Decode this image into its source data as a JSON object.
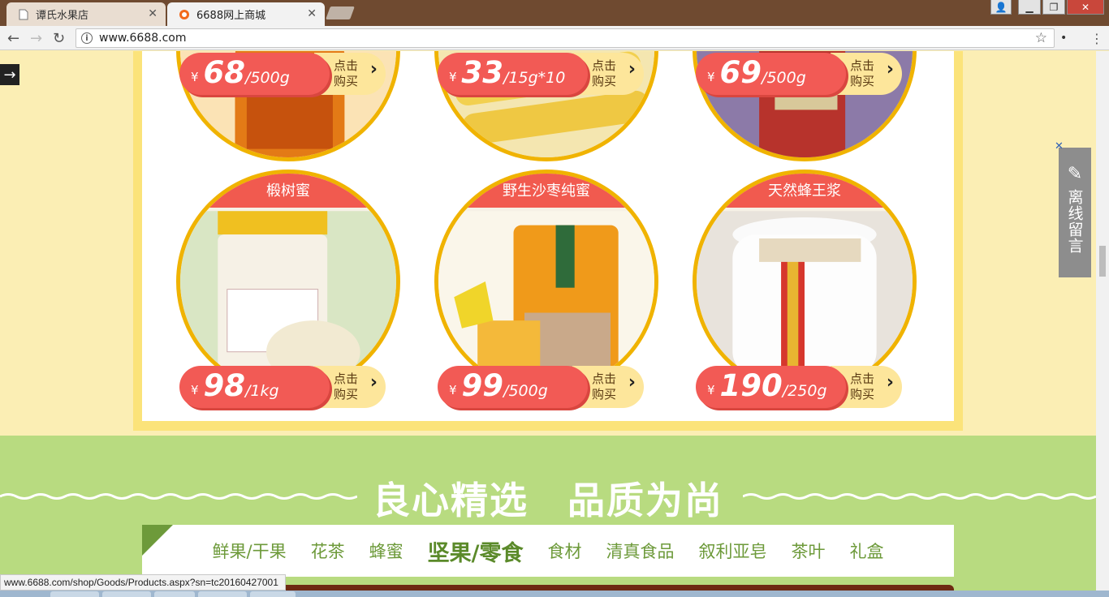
{
  "browser": {
    "tabs": [
      {
        "title": "谭氏水果店",
        "active": false,
        "icon": "page-icon"
      },
      {
        "title": "6688网上商城",
        "active": true,
        "icon": "site-logo-icon"
      }
    ],
    "url": "www.6688.com",
    "status_url": "www.6688.com/shop/Goods/Products.aspx?sn=tc20160427001"
  },
  "page": {
    "top_row": [
      {
        "price": "68",
        "unit": "/500g",
        "buy": "点击购买"
      },
      {
        "price": "33",
        "unit": "/15g*10",
        "buy": "点击购买"
      },
      {
        "price": "69",
        "unit": "/500g",
        "buy": "点击购买"
      }
    ],
    "bottom_row": [
      {
        "name": "椴树蜜",
        "price": "98",
        "unit": "/1kg",
        "buy": "点击购买"
      },
      {
        "name": "野生沙枣纯蜜",
        "price": "99",
        "unit": "/500g",
        "buy": "点击购买"
      },
      {
        "name": "天然蜂王浆",
        "price": "190",
        "unit": "/250g",
        "buy": "点击购买"
      }
    ],
    "currency": "¥",
    "buy_line1": "点击",
    "buy_line2": "购买",
    "slogan": "良心精选　品质为尚",
    "categories": [
      "鲜果/干果",
      "花茶",
      "蜂蜜",
      "坚果/零食",
      "食材",
      "清真食品",
      "叙利亚皂",
      "茶叶",
      "礼盒"
    ],
    "active_category": "坚果/零食",
    "float_message": "离线留言"
  },
  "colors": {
    "accent_red": "#f25a55",
    "gold_border": "#f0b300",
    "green_band": "#b8db80",
    "category_green": "#6d9a3a"
  }
}
